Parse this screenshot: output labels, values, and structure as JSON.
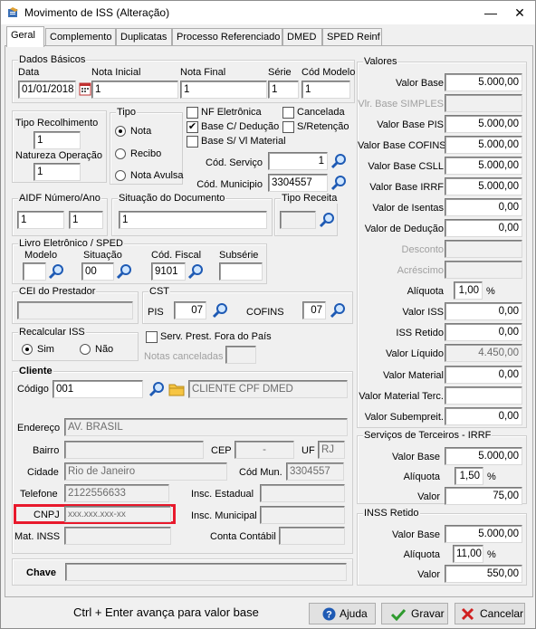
{
  "window": {
    "title": "Movimento de ISS (Alteração)",
    "minimize": "—",
    "close": "✕"
  },
  "tabs": [
    "Geral",
    "Complemento",
    "Duplicatas",
    "Processo Referenciado",
    "DMED",
    "SPED Reinf"
  ],
  "dados_basicos": {
    "legend": "Dados Básicos",
    "data_label": "Data",
    "data": "01/01/2018",
    "nota_inicial_label": "Nota Inicial",
    "nota_inicial": "1",
    "nota_final_label": "Nota Final",
    "nota_final": "1",
    "serie_label": "Série",
    "serie": "1",
    "cod_modelo_label": "Cód Modelo",
    "cod_modelo": "1"
  },
  "tipo_recolhimento": {
    "label": "Tipo Recolhimento",
    "value": "1",
    "natureza_label": "Natureza Operação",
    "natureza": "1"
  },
  "tipo": {
    "legend": "Tipo",
    "options": [
      "Nota",
      "Recibo",
      "Nota Avulsa"
    ]
  },
  "flags": {
    "nf_eletronica": "NF Eletrônica",
    "cancelada": "Cancelada",
    "base_deducao": "Base C/ Dedução",
    "s_retencao": "S/Retenção",
    "base_vl_material": "Base S/ Vl Material"
  },
  "servico": {
    "cod_servico_label": "Cód. Serviço",
    "cod_servico": "1",
    "cod_municipio_label": "Cód. Municipio",
    "cod_municipio": "3304557"
  },
  "aidf": {
    "legend": "AIDF Número/Ano",
    "numero": "1",
    "ano": "1"
  },
  "situacao": {
    "legend": "Situação do Documento",
    "value": "1"
  },
  "tipo_receita": {
    "legend": "Tipo Receita",
    "value": ""
  },
  "livro": {
    "legend": "Livro Eletrônico / SPED",
    "modelo_label": "Modelo",
    "modelo": "",
    "situacao_label": "Situação",
    "situacao": "00",
    "cod_fiscal_label": "Cód. Fiscal",
    "cod_fiscal": "9101",
    "subserie_label": "Subsérie",
    "subserie": ""
  },
  "cei": {
    "legend": "CEI do Prestador",
    "value": ""
  },
  "cst": {
    "legend": "CST",
    "pis_label": "PIS",
    "pis": "07",
    "cofins_label": "COFINS",
    "cofins": "07"
  },
  "recalcular": {
    "legend": "Recalcular ISS",
    "sim": "Sim",
    "nao": "Não"
  },
  "serv_prest": "Serv. Prest. Fora do País",
  "notas_canceladas": "Notas canceladas",
  "cliente": {
    "legend": "Cliente",
    "codigo_label": "Código",
    "codigo": "001",
    "nome": "CLIENTE CPF DMED",
    "endereco_label": "Endereço",
    "endereco": "AV. BRASIL",
    "bairro_label": "Bairro",
    "bairro": "",
    "cep_label": "CEP",
    "cep": "  -   ",
    "uf_label": "UF",
    "uf": "RJ",
    "cidade_label": "Cidade",
    "cidade": "Rio de Janeiro",
    "cod_mun_label": "Cód Mun.",
    "cod_mun": "3304557",
    "telefone_label": "Telefone",
    "telefone": "2122556633",
    "insc_estadual_label": "Insc. Estadual",
    "insc_estadual": "",
    "cnpj_label": "CNPJ",
    "cnpj": "xxx.xxx.xxx-xx",
    "insc_municipal_label": "Insc. Municipal",
    "insc_municipal": "",
    "mat_inss_label": "Mat. INSS",
    "mat_inss": "",
    "conta_contabil_label": "Conta Contábil",
    "conta_contabil": ""
  },
  "chave": {
    "label": "Chave",
    "value": ""
  },
  "valores": {
    "legend": "Valores",
    "rows": [
      {
        "label": "Valor Base",
        "value": "5.000,00",
        "state": "normal"
      },
      {
        "label": "Vlr. Base SIMPLES",
        "value": "",
        "state": "disabled"
      },
      {
        "label": "Valor Base PIS",
        "value": "5.000,00",
        "state": "normal"
      },
      {
        "label": "Valor Base COFINS",
        "value": "5.000,00",
        "state": "normal"
      },
      {
        "label": "Valor Base CSLL",
        "value": "5.000,00",
        "state": "normal"
      },
      {
        "label": "Valor Base IRRF",
        "value": "5.000,00",
        "state": "normal"
      },
      {
        "label": "Valor de Isentas",
        "value": "0,00",
        "state": "normal"
      },
      {
        "label": "Valor de Dedução",
        "value": "0,00",
        "state": "normal"
      },
      {
        "label": "Desconto",
        "value": "",
        "state": "disabled"
      },
      {
        "label": "Acréscimo",
        "value": "",
        "state": "disabled"
      },
      {
        "label": "Alíquota",
        "value": "1,00",
        "state": "aliquota"
      },
      {
        "label": "Valor ISS",
        "value": "0,00",
        "state": "normal"
      },
      {
        "label": "ISS Retido",
        "value": "0,00",
        "state": "normal"
      },
      {
        "label": "Valor Líquido",
        "value": "4.450,00",
        "state": "readonly"
      },
      {
        "label": "Valor Material",
        "value": "0,00",
        "state": "normal"
      },
      {
        "label": "Valor Material Terc.",
        "value": "",
        "state": "normal"
      },
      {
        "label": "Valor Subempreit.",
        "value": "0,00",
        "state": "normal"
      }
    ],
    "pct": "%"
  },
  "irrf": {
    "legend": "Serviços de Terceiros - IRRF",
    "base_label": "Valor Base",
    "base": "5.000,00",
    "aliquota_label": "Alíquota",
    "aliquota": "1,50",
    "valor_label": "Valor",
    "valor": "75,00",
    "pct": "%"
  },
  "inss": {
    "legend": "INSS Retido",
    "base_label": "Valor Base",
    "base": "5.000,00",
    "aliquota_label": "Alíquota",
    "aliquota": "11,00",
    "valor_label": "Valor",
    "valor": "550,00",
    "pct": "%"
  },
  "footer": {
    "hint": "Ctrl + Enter avança para valor base",
    "ajuda": "Ajuda",
    "gravar": "Gravar",
    "cancelar": "Cancelar"
  },
  "colors": {
    "highlight": "#e8192c",
    "blue_icon": "#1e5ab4"
  }
}
